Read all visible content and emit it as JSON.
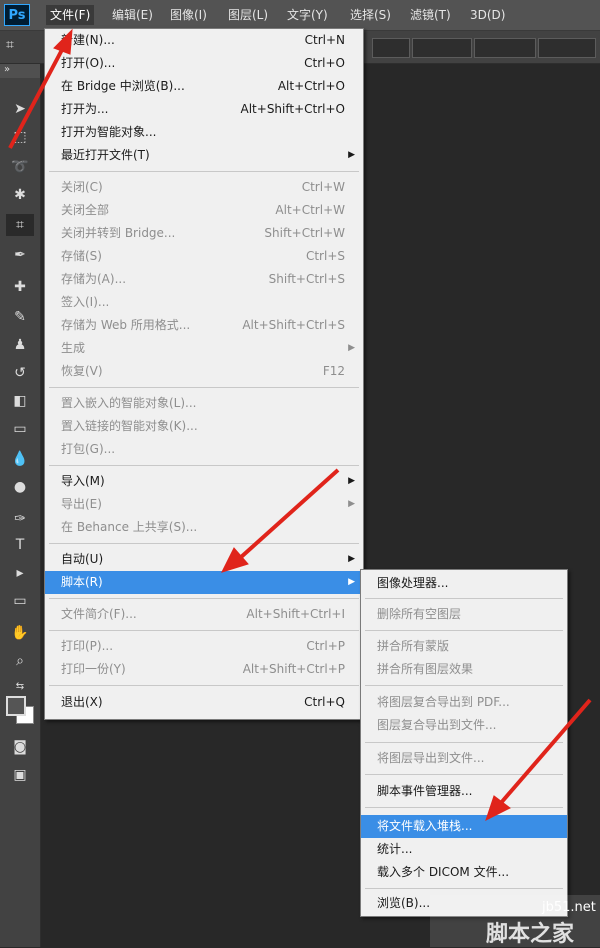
{
  "app": {
    "logo": "Ps"
  },
  "menubar": [
    {
      "label": "文件(F)",
      "active": true
    },
    {
      "label": "编辑(E)"
    },
    {
      "label": "图像(I)"
    },
    {
      "label": "图层(L)"
    },
    {
      "label": "文字(Y)"
    },
    {
      "label": "选择(S)"
    },
    {
      "label": "滤镜(T)"
    },
    {
      "label": "3D(D)"
    }
  ],
  "file_menu": [
    {
      "label": "新建(N)...",
      "shortcut": "Ctrl+N"
    },
    {
      "label": "打开(O)...",
      "shortcut": "Ctrl+O"
    },
    {
      "label": "在 Bridge 中浏览(B)...",
      "shortcut": "Alt+Ctrl+O"
    },
    {
      "label": "打开为...",
      "shortcut": "Alt+Shift+Ctrl+O"
    },
    {
      "label": "打开为智能对象..."
    },
    {
      "label": "最近打开文件(T)",
      "submenu": true
    },
    {
      "label": "关闭(C)",
      "shortcut": "Ctrl+W",
      "disabled": true
    },
    {
      "label": "关闭全部",
      "shortcut": "Alt+Ctrl+W",
      "disabled": true
    },
    {
      "label": "关闭并转到 Bridge...",
      "shortcut": "Shift+Ctrl+W",
      "disabled": true
    },
    {
      "label": "存储(S)",
      "shortcut": "Ctrl+S",
      "disabled": true
    },
    {
      "label": "存储为(A)...",
      "shortcut": "Shift+Ctrl+S",
      "disabled": true
    },
    {
      "label": "签入(I)...",
      "disabled": true
    },
    {
      "label": "存储为 Web 所用格式...",
      "shortcut": "Alt+Shift+Ctrl+S",
      "disabled": true
    },
    {
      "label": "生成",
      "submenu": true,
      "disabled": true
    },
    {
      "label": "恢复(V)",
      "shortcut": "F12",
      "disabled": true
    },
    {
      "label": "置入嵌入的智能对象(L)...",
      "disabled": true
    },
    {
      "label": "置入链接的智能对象(K)...",
      "disabled": true
    },
    {
      "label": "打包(G)...",
      "disabled": true
    },
    {
      "label": "导入(M)",
      "submenu": true
    },
    {
      "label": "导出(E)",
      "submenu": true,
      "disabled": true
    },
    {
      "label": "在 Behance 上共享(S)...",
      "disabled": true
    },
    {
      "label": "自动(U)",
      "submenu": true
    },
    {
      "label": "脚本(R)",
      "submenu": true,
      "highlighted": true
    },
    {
      "label": "文件简介(F)...",
      "shortcut": "Alt+Shift+Ctrl+I",
      "disabled": true
    },
    {
      "label": "打印(P)...",
      "shortcut": "Ctrl+P",
      "disabled": true
    },
    {
      "label": "打印一份(Y)",
      "shortcut": "Alt+Shift+Ctrl+P",
      "disabled": true
    },
    {
      "label": "退出(X)",
      "shortcut": "Ctrl+Q"
    }
  ],
  "scripts_submenu": [
    {
      "label": "图像处理器..."
    },
    {
      "label": "删除所有空图层",
      "disabled": true
    },
    {
      "label": "拼合所有蒙版",
      "disabled": true
    },
    {
      "label": "拼合所有图层效果",
      "disabled": true
    },
    {
      "label": "将图层复合导出到 PDF...",
      "disabled": true
    },
    {
      "label": "图层复合导出到文件...",
      "disabled": true
    },
    {
      "label": "将图层导出到文件...",
      "disabled": true
    },
    {
      "label": "脚本事件管理器..."
    },
    {
      "label": "将文件载入堆栈...",
      "highlighted": true
    },
    {
      "label": "统计..."
    },
    {
      "label": "载入多个 DICOM 文件..."
    },
    {
      "label": "浏览(B)..."
    }
  ],
  "tools": [
    {
      "icon": "move-tool-icon",
      "glyph": "➤"
    },
    {
      "icon": "marquee-tool-icon",
      "glyph": "⬚"
    },
    {
      "icon": "lasso-tool-icon",
      "glyph": "➰"
    },
    {
      "icon": "magic-wand-tool-icon",
      "glyph": "✱"
    },
    {
      "icon": "crop-tool-icon",
      "glyph": "⌗"
    },
    {
      "icon": "eyedropper-tool-icon",
      "glyph": "✒"
    },
    {
      "icon": "healing-brush-tool-icon",
      "glyph": "✚"
    },
    {
      "icon": "brush-tool-icon",
      "glyph": "✎"
    },
    {
      "icon": "clone-stamp-tool-icon",
      "glyph": "♟"
    },
    {
      "icon": "history-brush-tool-icon",
      "glyph": "↺"
    },
    {
      "icon": "eraser-tool-icon",
      "glyph": "◧"
    },
    {
      "icon": "gradient-tool-icon",
      "glyph": "▭"
    },
    {
      "icon": "blur-tool-icon",
      "glyph": "💧"
    },
    {
      "icon": "dodge-tool-icon",
      "glyph": "●"
    },
    {
      "icon": "pen-tool-icon",
      "glyph": "✑"
    },
    {
      "icon": "type-tool-icon",
      "glyph": "T"
    },
    {
      "icon": "path-selection-tool-icon",
      "glyph": "▸"
    },
    {
      "icon": "rectangle-tool-icon",
      "glyph": "▭"
    },
    {
      "icon": "hand-tool-icon",
      "glyph": "✋"
    },
    {
      "icon": "zoom-tool-icon",
      "glyph": "⌕"
    }
  ],
  "watermark": {
    "domain": "jb51.net",
    "name": "脚本之家"
  },
  "colors": {
    "highlight": "#3a8ee6",
    "arrow": "#e0241b"
  }
}
